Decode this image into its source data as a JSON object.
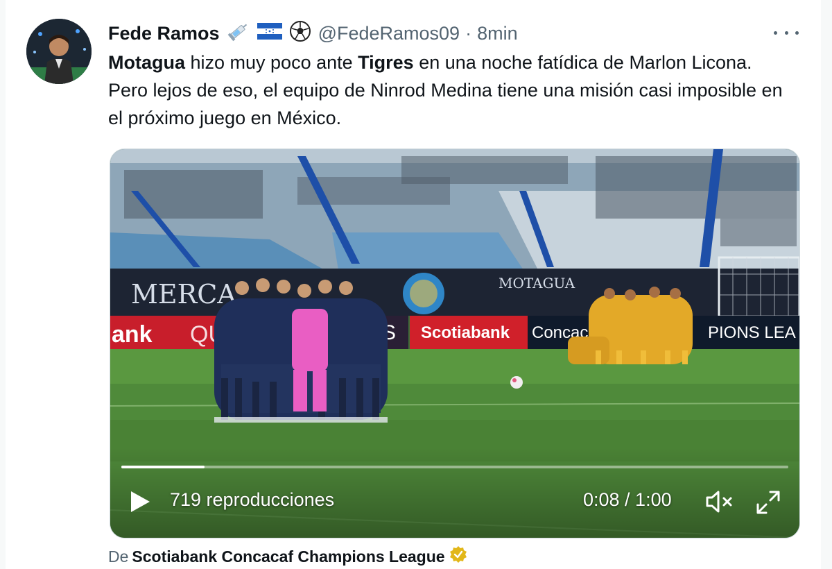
{
  "tweet": {
    "author_name": "Fede Ramos",
    "handle": "@FedeRamos09",
    "separator": "·",
    "time": "8min",
    "text": {
      "part1_bold": "Motagua",
      "part2": " hizo muy poco ante ",
      "part3_bold": "Tigres",
      "part4": " en una noche fatídica de Marlon Licona. Pero lejos de eso, el equipo de Ninrod Medina tiene una misión casi imposible en el próximo juego en México."
    },
    "header_icons": [
      "syringe-emoji",
      "honduras-flag-emoji",
      "soccer-ball-emoji"
    ]
  },
  "video": {
    "views": "719 reproducciones",
    "timecode": "0:08 / 1:00",
    "progress_fraction": 0.125,
    "controls": [
      "play-icon",
      "mute-icon",
      "fullscreen-icon"
    ],
    "ad_boards": [
      "ank",
      "QUI",
      "YS",
      "Scotiabank",
      "Concac",
      "PIONS LEA"
    ],
    "banner_texts": [
      "MERCA",
      "MOTAGUA"
    ]
  },
  "source": {
    "prefix": "De",
    "name": "Scotiabank Concacaf Champions League"
  },
  "colors": {
    "verified_gold": "#e2b719",
    "text_secondary": "#536471",
    "board_red": "#d0202a"
  }
}
